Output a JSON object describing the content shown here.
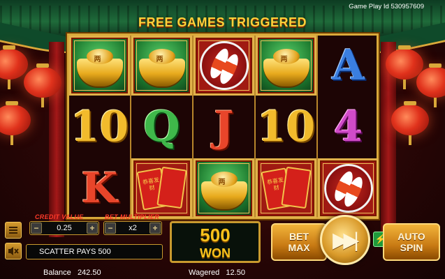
{
  "banner": {
    "title": "FREE GAMES TRIGGERED"
  },
  "game_id": "Game Play Id 530957609",
  "reels": [
    [
      {
        "symbol": "gold-ingot",
        "text": "两"
      },
      {
        "symbol": "10",
        "text": "10",
        "color": "gold"
      },
      {
        "symbol": "K",
        "text": "K",
        "color": "red"
      }
    ],
    [
      {
        "symbol": "gold-ingot",
        "text": "两"
      },
      {
        "symbol": "Q",
        "text": "Q",
        "color": "green"
      },
      {
        "symbol": "red-envelopes",
        "text": "恭喜发财"
      }
    ],
    [
      {
        "symbol": "koi-fish"
      },
      {
        "symbol": "J",
        "text": "J",
        "color": "red"
      },
      {
        "symbol": "gold-ingot",
        "text": "两"
      }
    ],
    [
      {
        "symbol": "gold-ingot",
        "text": "两"
      },
      {
        "symbol": "10",
        "text": "10",
        "color": "gold"
      },
      {
        "symbol": "red-envelopes",
        "text": "恭喜发财"
      }
    ],
    [
      {
        "symbol": "A",
        "text": "A",
        "color": "blue"
      },
      {
        "symbol": "4",
        "text": "4",
        "color": "purple"
      },
      {
        "symbol": "koi-fish"
      }
    ]
  ],
  "controls": {
    "credit_value_label": "CREDIT VALUE",
    "credit_value": "0.25",
    "bet_multiplier_label": "BET MULTIPLIER",
    "bet_multiplier": "x2",
    "minus": "−",
    "plus": "+",
    "message": "SCATTER PAYS 500",
    "win_amount": "500",
    "win_label": "WON",
    "bet_max_label": "BET MAX",
    "auto_spin_label": "AUTO SPIN",
    "spin_icon": "skip-forward-icon",
    "bolt": "⚡"
  },
  "status": {
    "balance_label": "Balance",
    "balance_value": "242.50",
    "wagered_label": "Wagered",
    "wagered_value": "12.50"
  },
  "colors": {
    "gold": "#f2bb2c",
    "red_accent": "#ff3a2a",
    "roof_green": "#1f6b3a",
    "win_yellow": "#f7c21c"
  }
}
